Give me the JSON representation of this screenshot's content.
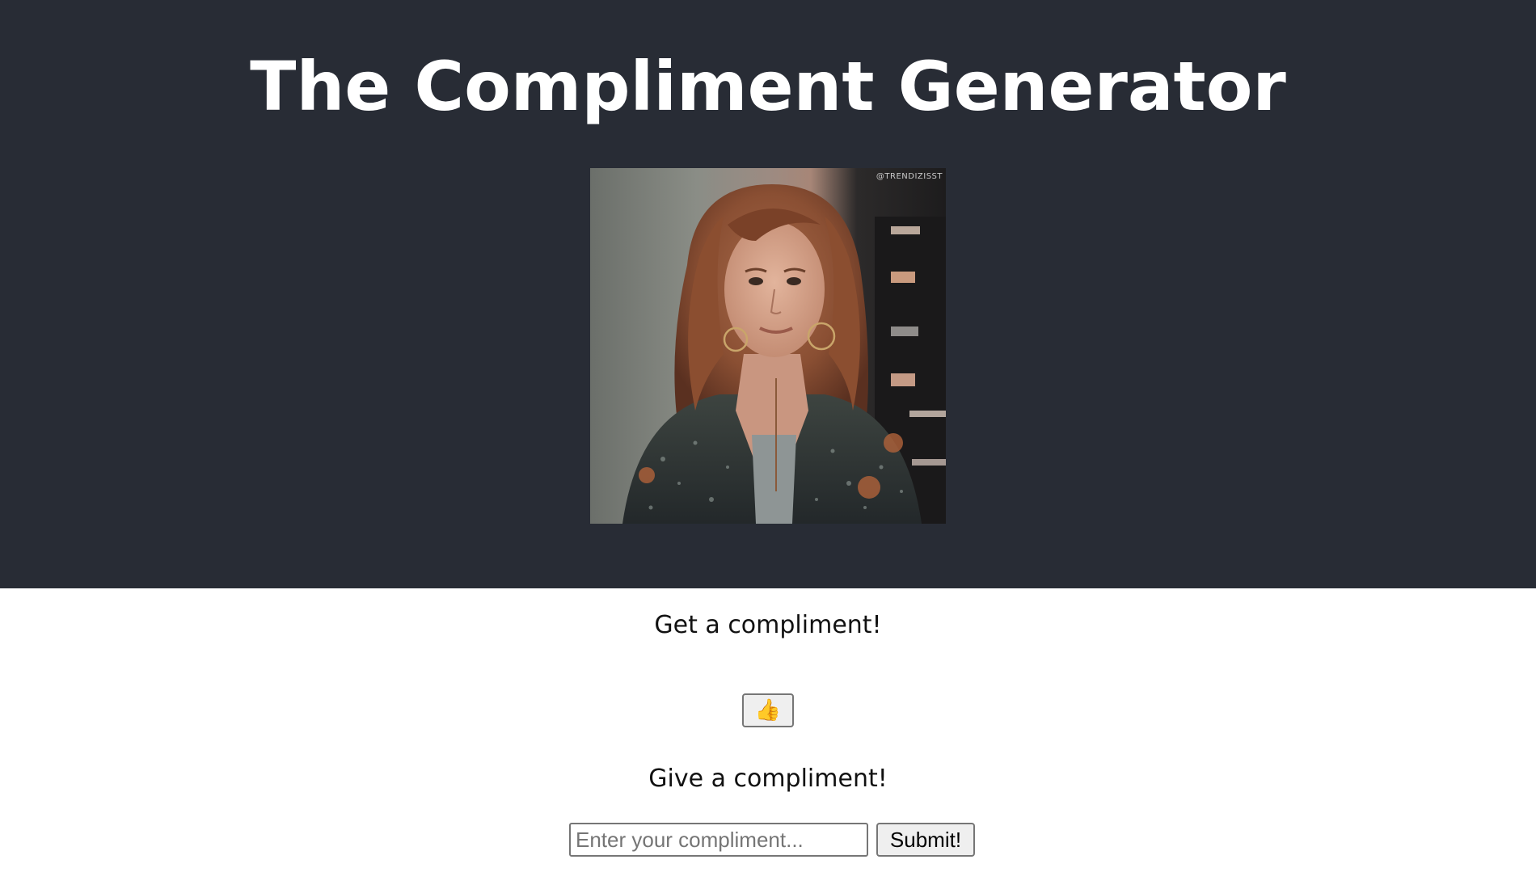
{
  "header": {
    "title": "The Compliment Generator",
    "background": "#282c35",
    "title_color": "#ffffff"
  },
  "image": {
    "watermark": "@TRENDIZISST",
    "alt": "gif"
  },
  "get_section": {
    "heading": "Get a compliment!",
    "button_label": "👍",
    "button_icon": "thumbs-up-icon"
  },
  "give_section": {
    "heading": "Give a compliment!",
    "input_value": "",
    "input_placeholder": "Enter your compliment...",
    "submit_label": "Submit!"
  }
}
